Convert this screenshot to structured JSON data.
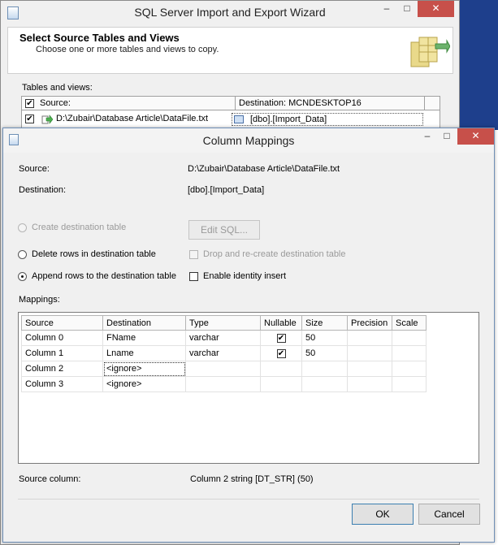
{
  "wizard": {
    "title": "SQL Server Import and Export Wizard",
    "header_title": "Select Source Tables and Views",
    "header_subtitle": "Choose one or more tables and views to copy.",
    "tables_label": "Tables and views:",
    "col_source": "Source:",
    "col_destination": "Destination: MCNDESKTOP16",
    "row_source": "D:\\Zubair\\Database Article\\DataFile.txt",
    "row_destination": "[dbo].[Import_Data]",
    "min_glyph": "–",
    "max_glyph": "□",
    "close_glyph": "✕"
  },
  "dialog": {
    "title": "Column Mappings",
    "source_label": "Source:",
    "source_value": "D:\\Zubair\\Database Article\\DataFile.txt",
    "destination_label": "Destination:",
    "destination_value": "[dbo].[Import_Data]",
    "options": {
      "create_table": "Create destination table",
      "edit_sql": "Edit SQL...",
      "delete_rows": "Delete rows in destination table",
      "drop_recreate": "Drop and re-create destination table",
      "append_rows": "Append rows to the destination table",
      "identity_insert": "Enable identity insert"
    },
    "mappings_label": "Mappings:",
    "columns": [
      "Source",
      "Destination",
      "Type",
      "Nullable",
      "Size",
      "Precision",
      "Scale"
    ],
    "rows": [
      {
        "source": "Column 0",
        "destination": "FName",
        "type": "varchar",
        "nullable": true,
        "size": "50",
        "precision": "",
        "scale": ""
      },
      {
        "source": "Column 1",
        "destination": "Lname",
        "type": "varchar",
        "nullable": true,
        "size": "50",
        "precision": "",
        "scale": ""
      },
      {
        "source": "Column 2",
        "destination": "<ignore>",
        "type": "",
        "nullable": false,
        "size": "",
        "precision": "",
        "scale": ""
      },
      {
        "source": "Column 3",
        "destination": "<ignore>",
        "type": "",
        "nullable": false,
        "size": "",
        "precision": "",
        "scale": ""
      }
    ],
    "source_column_label": "Source column:",
    "source_column_value": "Column 2 string [DT_STR] (50)",
    "ok": "OK",
    "cancel": "Cancel",
    "close_glyph": "✕",
    "min_glyph": "–",
    "max_glyph": "□"
  }
}
